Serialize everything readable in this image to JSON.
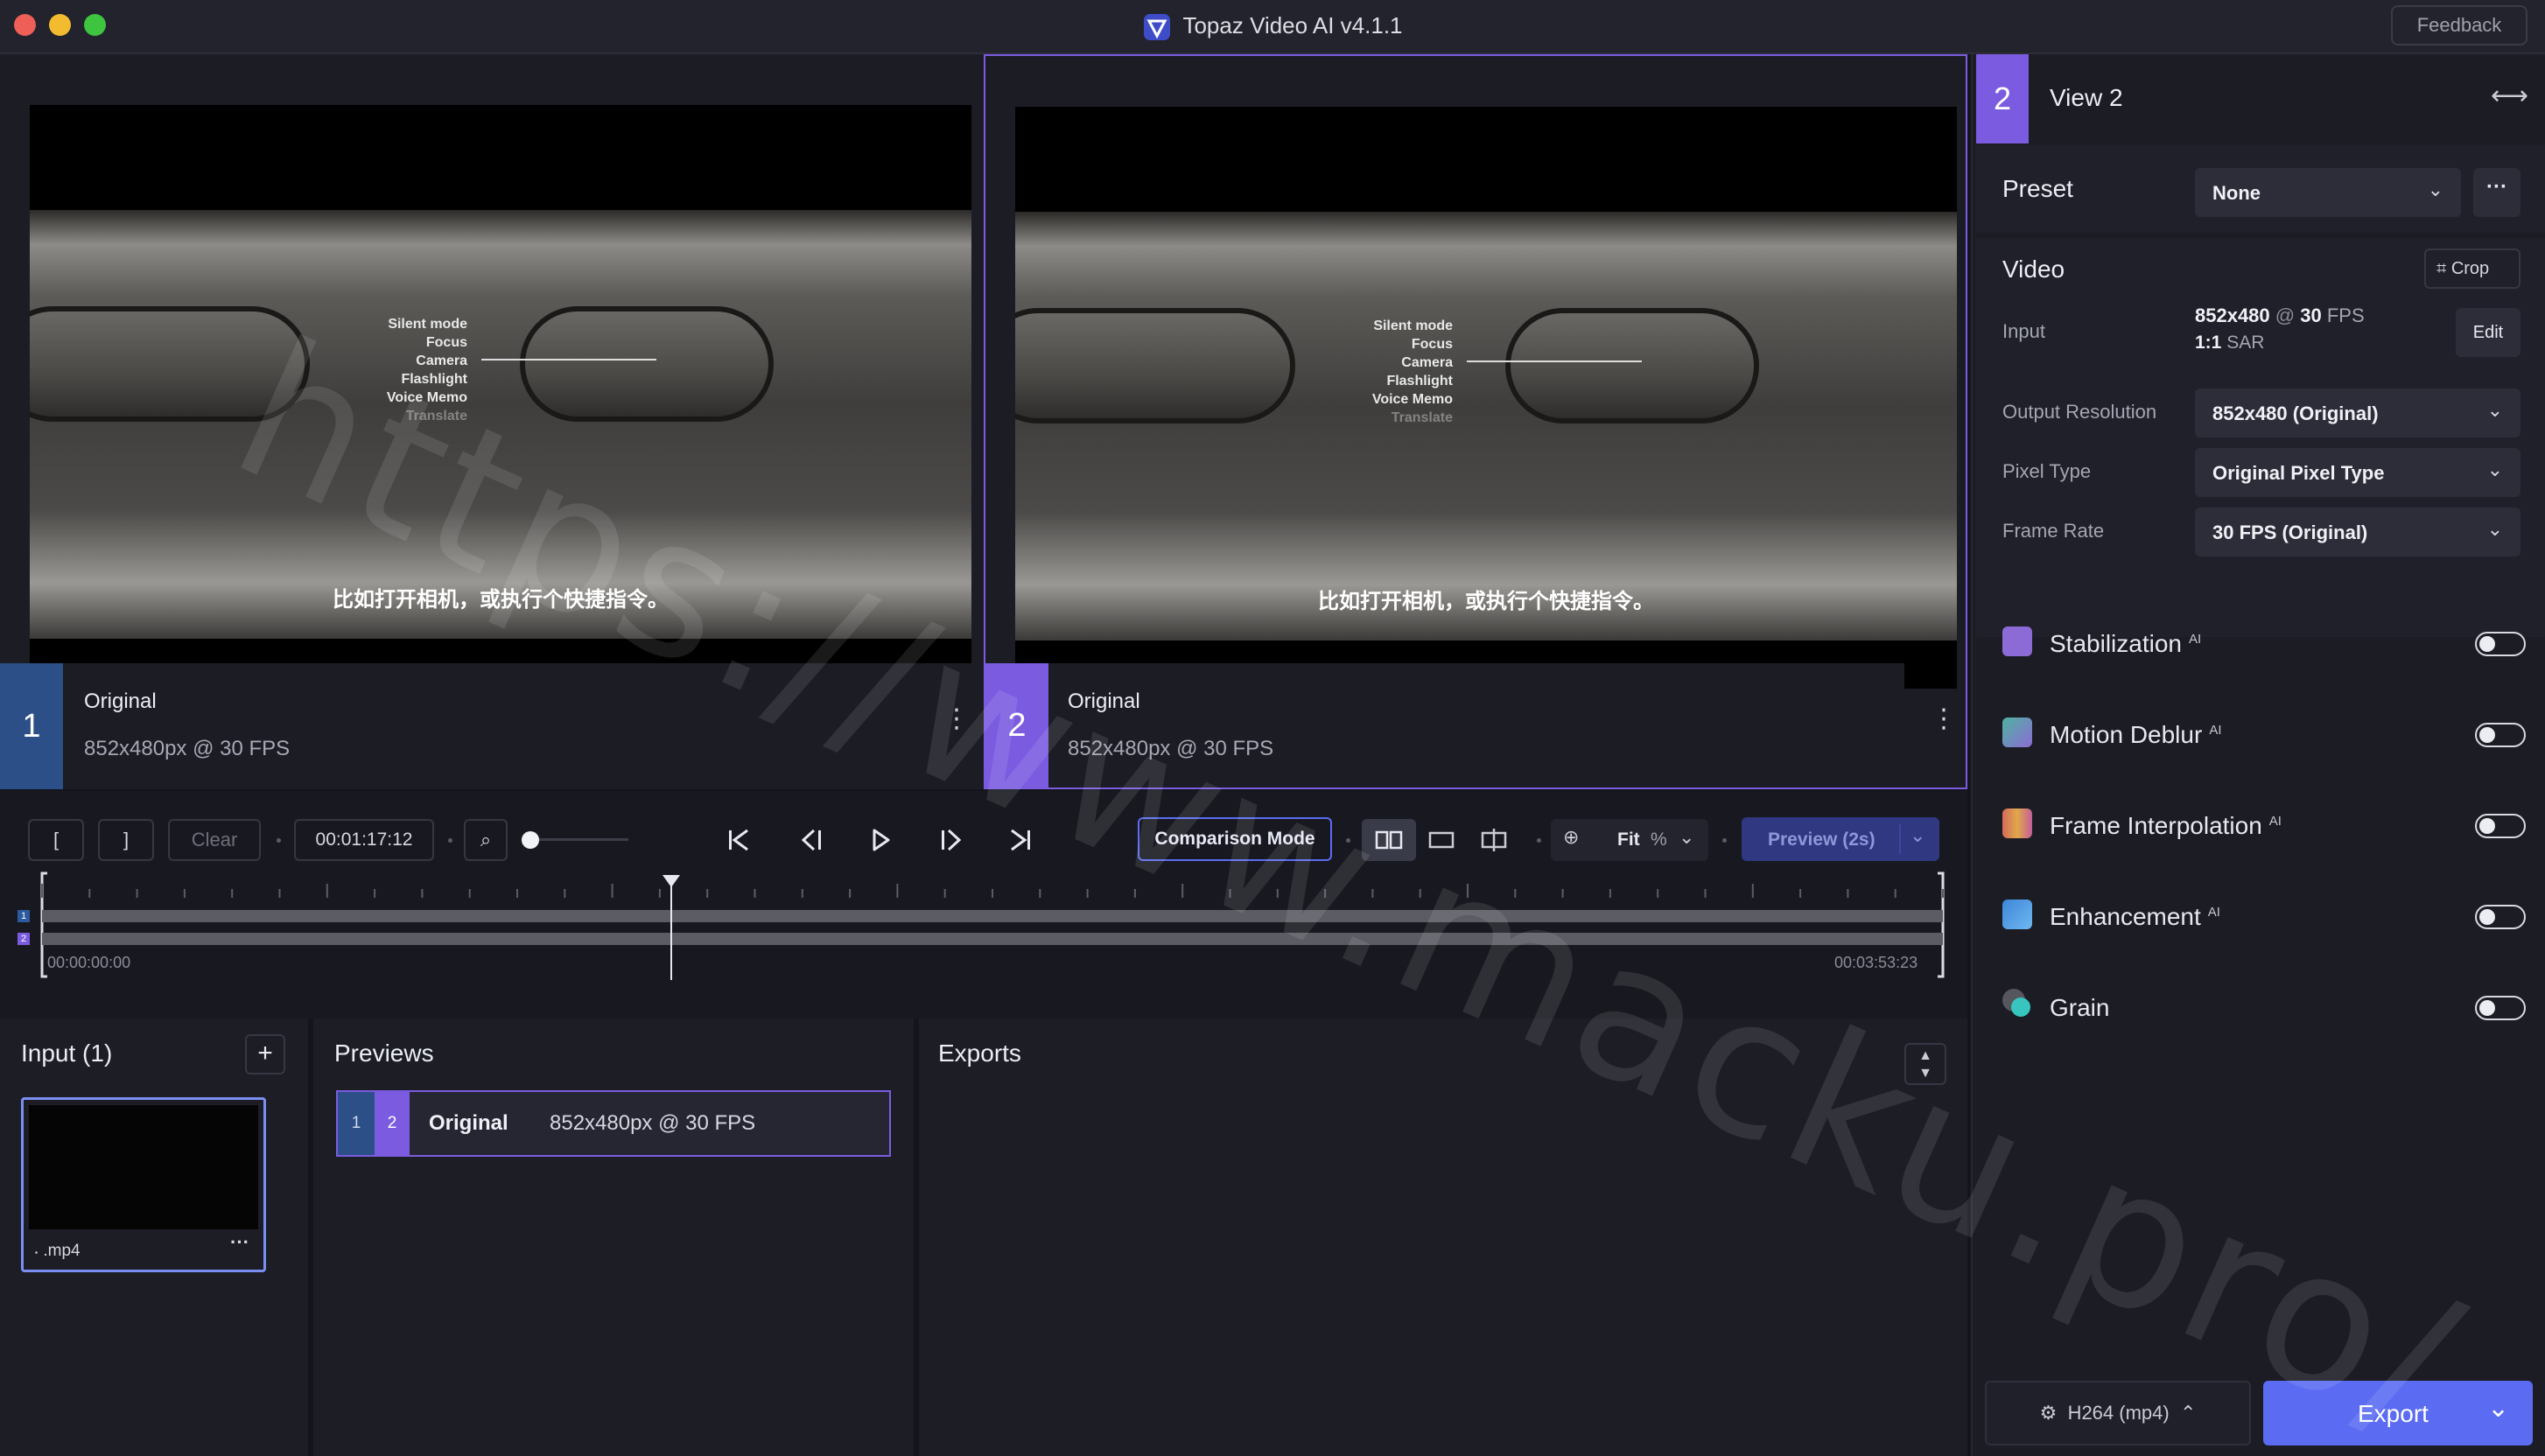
{
  "window": {
    "title": "Topaz Video AI  v4.1.1",
    "feedback_label": "Feedback"
  },
  "viewers": [
    {
      "number": "1",
      "title": "Original",
      "subtitle": "852x480px @ 30 FPS",
      "subtitle_text": "比如打开相机，或执行个快捷指令。",
      "menu_lines": [
        "Silent mode",
        "Focus",
        "Camera",
        "Flashlight",
        "Voice Memo",
        "Translate"
      ]
    },
    {
      "number": "2",
      "title": "Original",
      "subtitle": "852x480px @ 30 FPS",
      "subtitle_text": "比如打开相机，或执行个快捷指令。",
      "menu_lines": [
        "Silent mode",
        "Focus",
        "Camera",
        "Flashlight",
        "Voice Memo",
        "Translate"
      ]
    }
  ],
  "controls": {
    "mark_in": "[",
    "mark_out": "]",
    "clear": "Clear",
    "timecode": "00:01:17:12",
    "comparison_mode": "Comparison Mode",
    "zoom": "Fit",
    "zoom_unit": "%",
    "preview": "Preview (2s)"
  },
  "timeline": {
    "start": "00:00:00:00",
    "end": "00:03:53:23",
    "tracks": [
      "1",
      "2"
    ],
    "playhead_fraction": 0.331
  },
  "input_panel": {
    "title": "Input (1)",
    "file_name": ".mp4"
  },
  "previews_panel": {
    "title": "Previews",
    "item": {
      "badges": [
        "1",
        "2"
      ],
      "name": "Original",
      "detail": "852x480px @ 30 FPS"
    }
  },
  "exports_panel": {
    "title": "Exports"
  },
  "right_panel": {
    "view_number": "2",
    "view_title": "View 2",
    "preset_label": "Preset",
    "preset_value": "None",
    "video_label": "Video",
    "crop_label": "Crop",
    "input_label": "Input",
    "input_res": "852x480",
    "input_at": "@",
    "input_fps": "30",
    "input_fps_unit": "FPS",
    "input_sar": "1:1",
    "input_sar_unit": "SAR",
    "edit_label": "Edit",
    "output_resolution_label": "Output Resolution",
    "output_resolution_value": "852x480 (Original)",
    "pixel_type_label": "Pixel Type",
    "pixel_type_value": "Original Pixel Type",
    "frame_rate_label": "Frame Rate",
    "frame_rate_value": "30 FPS (Original)",
    "features": [
      {
        "name": "Stabilization",
        "badge": "AI",
        "color": "#8d6bd6",
        "enabled": false
      },
      {
        "name": "Motion Deblur",
        "badge": "AI",
        "color": "#4fb3a0",
        "enabled": false
      },
      {
        "name": "Frame Interpolation",
        "badge": "AI",
        "color": "#d46a5b",
        "enabled": false
      },
      {
        "name": "Enhancement",
        "badge": "AI",
        "color": "#3d86d8",
        "enabled": false
      },
      {
        "name": "Grain",
        "badge": "",
        "color": "#38c5c0",
        "enabled": false
      }
    ],
    "codec": "H264 (mp4)",
    "export_label": "Export"
  },
  "watermark": "https://www.macku.pro/",
  "colors": {
    "accent_purple": "#7b5ce0",
    "accent_blue": "#3d5aa8",
    "export_blue": "#5b6cf2"
  }
}
